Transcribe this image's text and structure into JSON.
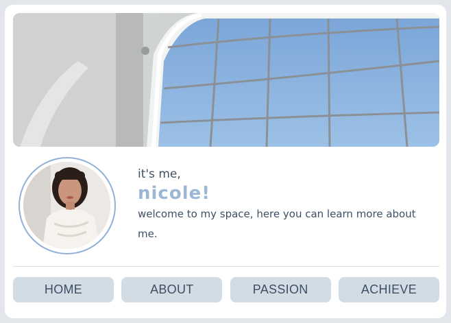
{
  "profile": {
    "greeting": "it's me,",
    "name": "nicole!",
    "welcome": "welcome to my space, here you can learn more about me."
  },
  "nav": {
    "items": [
      {
        "label": "HOME"
      },
      {
        "label": "ABOUT"
      },
      {
        "label": "PASSION"
      },
      {
        "label": "ACHIEVE"
      }
    ]
  },
  "colors": {
    "accent": "#8fb1d8",
    "button_bg": "#d2dce5",
    "text": "#3e4f63"
  }
}
